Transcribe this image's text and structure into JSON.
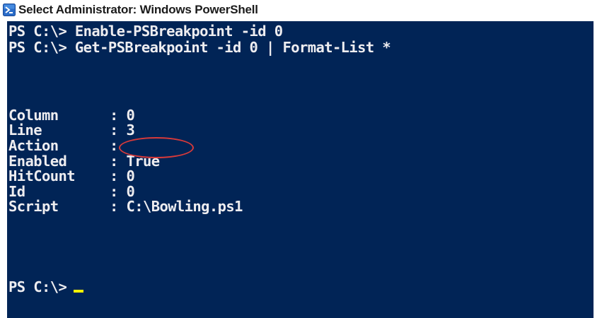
{
  "window": {
    "title": "Select Administrator: Windows PowerShell",
    "icon": "powershell-icon"
  },
  "console": {
    "background_color": "#012456",
    "text_color": "#eeedf0",
    "commands": [
      "PS C:\\> Enable-PSBreakpoint -id 0",
      "PS C:\\> Get-PSBreakpoint -id 0 | Format-List *"
    ],
    "properties": [
      {
        "name": "Column",
        "value": ": 0"
      },
      {
        "name": "Line",
        "value": ": 3"
      },
      {
        "name": "Action",
        "value": ":"
      },
      {
        "name": "Enabled",
        "value": ": True"
      },
      {
        "name": "HitCount",
        "value": ": 0"
      },
      {
        "name": "Id",
        "value": ": 0"
      },
      {
        "name": "Script",
        "value": ": C:\\Bowling.ps1"
      }
    ],
    "prompt": "PS C:\\>",
    "highlight_color": "#d83a3a",
    "cursor_color": "#f6f200"
  }
}
